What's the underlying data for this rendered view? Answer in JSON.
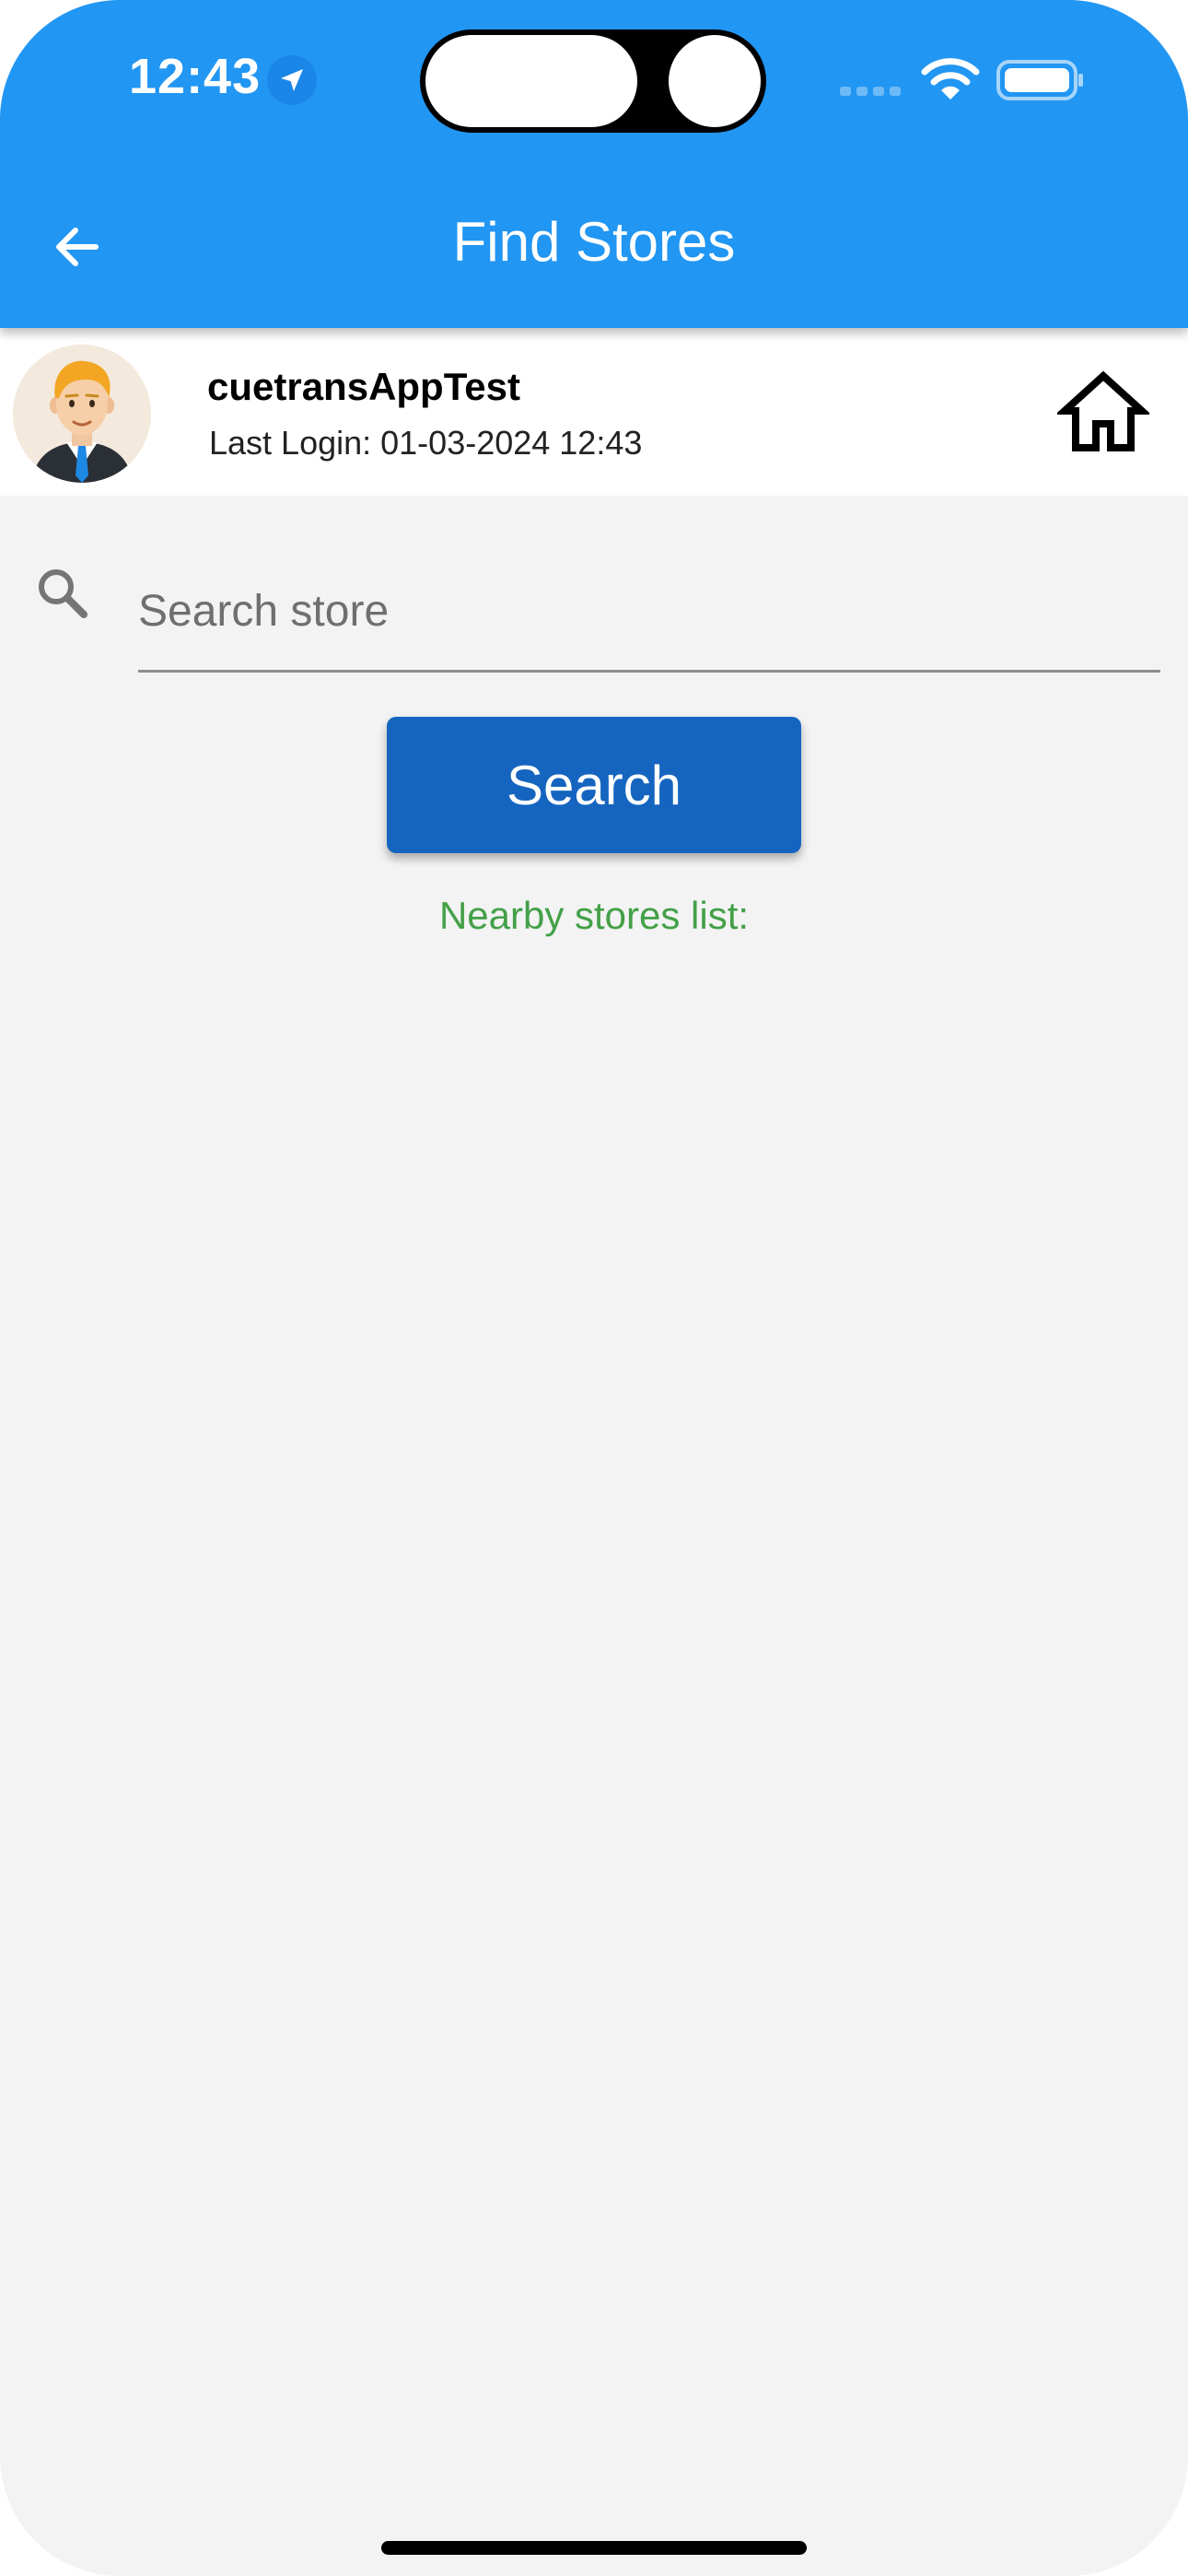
{
  "status_bar": {
    "time": "12:43",
    "icons": [
      "location-arrow-icon",
      "cellular-signal-icon",
      "wifi-icon",
      "battery-icon"
    ]
  },
  "app_bar": {
    "title": "Find Stores",
    "back_icon": "arrow-left-icon",
    "background_color": "#2196f3"
  },
  "user": {
    "username": "cuetransAppTest",
    "last_login": "Last Login: 01-03-2024 12:43",
    "avatar_icon": "businessman-avatar",
    "home_icon": "home-icon"
  },
  "search": {
    "placeholder": "Search store",
    "value": "",
    "button_label": "Search",
    "button_color": "#1565c0"
  },
  "results": {
    "label": "Nearby stores list:",
    "label_color": "#43a047",
    "items": []
  }
}
